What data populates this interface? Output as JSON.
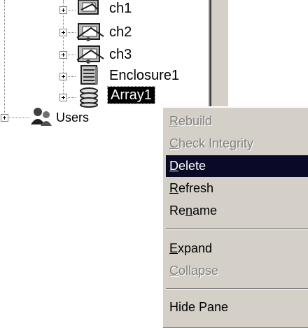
{
  "tree": {
    "nodes": [
      {
        "label": "ch1",
        "icon": "channel-icon",
        "expandable": true
      },
      {
        "label": "ch2",
        "icon": "channel-icon",
        "expandable": true
      },
      {
        "label": "ch3",
        "icon": "channel-icon",
        "expandable": true
      },
      {
        "label": "Enclosure1",
        "icon": "enclosure-icon",
        "expandable": true
      },
      {
        "label": "Array1",
        "icon": "array-icon",
        "expandable": true,
        "selected": true
      }
    ],
    "users": {
      "label": "Users",
      "icon": "users-icon",
      "expandable": true
    }
  },
  "context_menu": {
    "items": [
      {
        "pre": "",
        "key": "R",
        "post": "ebuild",
        "disabled": true
      },
      {
        "pre": "",
        "key": "C",
        "post": "heck Integrity",
        "disabled": true
      },
      {
        "pre": "",
        "key": "D",
        "post": "elete",
        "highlighted": true
      },
      {
        "pre": "",
        "key": "R",
        "post": "efresh"
      },
      {
        "pre": "Re",
        "key": "n",
        "post": "ame"
      },
      {
        "pre": "",
        "key": "E",
        "post": "xpand"
      },
      {
        "pre": "",
        "key": "C",
        "post": "ollapse",
        "disabled": true
      },
      {
        "pre": "Hide Pane",
        "key": "",
        "post": ""
      }
    ]
  },
  "colors": {
    "menu_background": "#d4d0c8",
    "highlight": "#0a0a28",
    "disabled_text": "#808080"
  }
}
